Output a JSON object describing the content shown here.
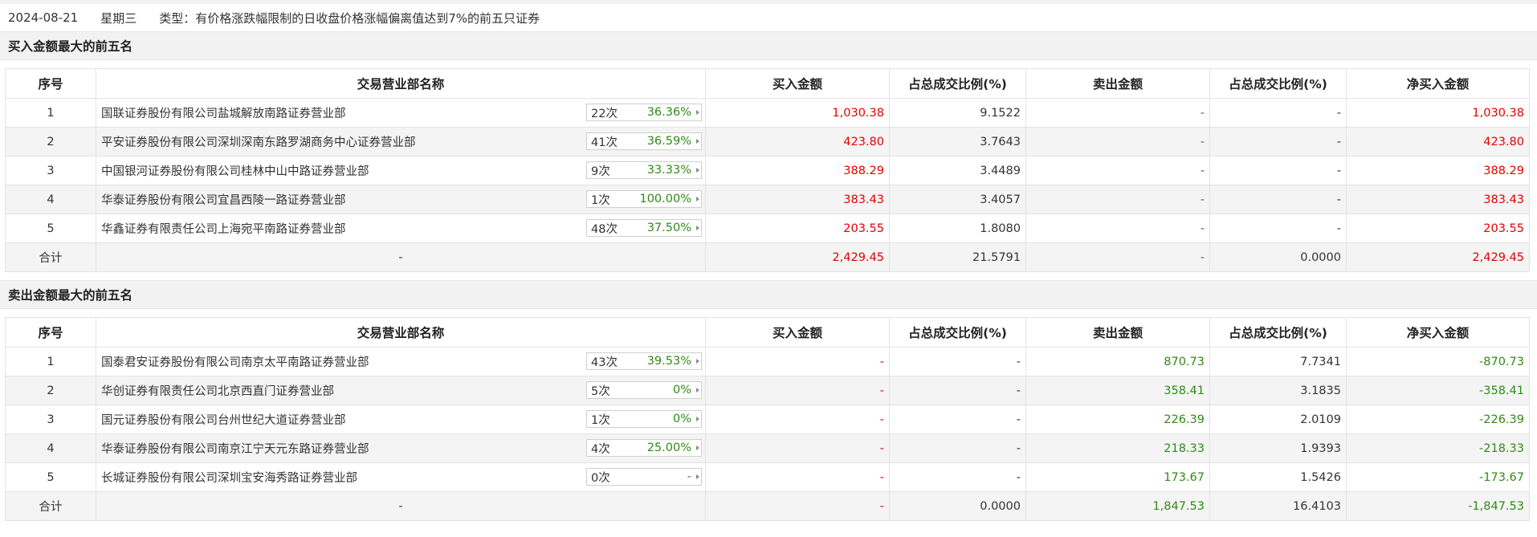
{
  "info": {
    "date": "2024-08-21",
    "weekday": "星期三",
    "type": "类型：有价格涨跌幅限制的日收盘价格涨幅偏离值达到7%的前五只证券"
  },
  "headers": [
    "序号",
    "交易营业部名称",
    "买入金额",
    "占总成交比例(%)",
    "卖出金额",
    "占总成交比例(%)",
    "净买入金额"
  ],
  "buy_section": {
    "title": "买入金额最大的前五名",
    "rows": [
      {
        "idx": "1",
        "name": "国联证券股份有限公司盐城解放南路证券营业部",
        "count": "22次",
        "pct": "36.36%",
        "buy": "1,030.38",
        "buy_ratio": "9.1522",
        "sell": "-",
        "sell_ratio": "-",
        "net": "1,030.38"
      },
      {
        "idx": "2",
        "name": "平安证券股份有限公司深圳深南东路罗湖商务中心证券营业部",
        "count": "41次",
        "pct": "36.59%",
        "buy": "423.80",
        "buy_ratio": "3.7643",
        "sell": "-",
        "sell_ratio": "-",
        "net": "423.80"
      },
      {
        "idx": "3",
        "name": "中国银河证券股份有限公司桂林中山中路证券营业部",
        "count": "9次",
        "pct": "33.33%",
        "buy": "388.29",
        "buy_ratio": "3.4489",
        "sell": "-",
        "sell_ratio": "-",
        "net": "388.29"
      },
      {
        "idx": "4",
        "name": "华泰证券股份有限公司宜昌西陵一路证券营业部",
        "count": "1次",
        "pct": "100.00%",
        "buy": "383.43",
        "buy_ratio": "3.4057",
        "sell": "-",
        "sell_ratio": "-",
        "net": "383.43"
      },
      {
        "idx": "5",
        "name": "华鑫证券有限责任公司上海宛平南路证券营业部",
        "count": "48次",
        "pct": "37.50%",
        "buy": "203.55",
        "buy_ratio": "1.8080",
        "sell": "-",
        "sell_ratio": "-",
        "net": "203.55"
      }
    ],
    "total": {
      "label": "合计",
      "name": "-",
      "buy": "2,429.45",
      "buy_ratio": "21.5791",
      "sell": "-",
      "sell_ratio": "0.0000",
      "net": "2,429.45"
    }
  },
  "sell_section": {
    "title": "卖出金额最大的前五名",
    "rows": [
      {
        "idx": "1",
        "name": "国泰君安证券股份有限公司南京太平南路证券营业部",
        "count": "43次",
        "pct": "39.53%",
        "buy": "-",
        "buy_ratio": "-",
        "sell": "870.73",
        "sell_ratio": "7.7341",
        "net": "-870.73"
      },
      {
        "idx": "2",
        "name": "华创证券有限责任公司北京西直门证券营业部",
        "count": "5次",
        "pct": "0%",
        "buy": "-",
        "buy_ratio": "-",
        "sell": "358.41",
        "sell_ratio": "3.1835",
        "net": "-358.41"
      },
      {
        "idx": "3",
        "name": "国元证券股份有限公司台州世纪大道证券营业部",
        "count": "1次",
        "pct": "0%",
        "buy": "-",
        "buy_ratio": "-",
        "sell": "226.39",
        "sell_ratio": "2.0109",
        "net": "-226.39"
      },
      {
        "idx": "4",
        "name": "华泰证券股份有限公司南京江宁天元东路证券营业部",
        "count": "4次",
        "pct": "25.00%",
        "buy": "-",
        "buy_ratio": "-",
        "sell": "218.33",
        "sell_ratio": "1.9393",
        "net": "-218.33"
      },
      {
        "idx": "5",
        "name": "长城证券股份有限公司深圳宝安海秀路证券营业部",
        "count": "0次",
        "pct": "-",
        "buy": "-",
        "buy_ratio": "-",
        "sell": "173.67",
        "sell_ratio": "1.5426",
        "net": "-173.67"
      }
    ],
    "total": {
      "label": "合计",
      "name": "-",
      "buy": "-",
      "buy_ratio": "0.0000",
      "sell": "1,847.53",
      "sell_ratio": "16.4103",
      "net": "-1,847.53"
    }
  },
  "colors": {
    "up": "#e60000",
    "down": "#2e8b14",
    "header_bg": "#f2f2f2",
    "row_alt": "#f4f4f4"
  }
}
